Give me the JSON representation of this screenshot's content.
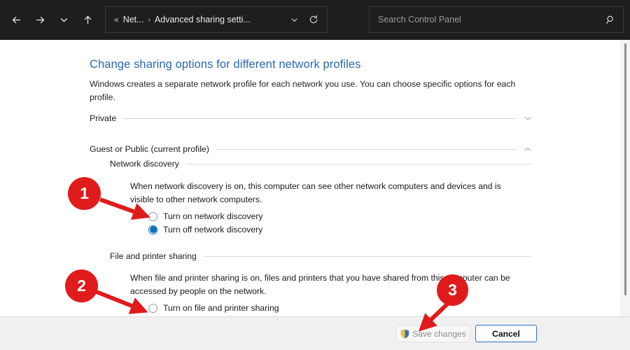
{
  "titlebar": {
    "nav": [
      {
        "name": "back",
        "label": "Back"
      },
      {
        "name": "forward",
        "label": "Forward"
      },
      {
        "name": "recent",
        "label": "Recent locations"
      },
      {
        "name": "up",
        "label": "Up"
      }
    ],
    "address": {
      "overflow_glyph": "«",
      "crumb1": "Net...",
      "separator": "›",
      "crumb2": "Advanced sharing setti...",
      "dropdown_glyph": "⌵",
      "refresh_label": "Refresh"
    },
    "search": {
      "placeholder": "Search Control Panel",
      "value": ""
    }
  },
  "main": {
    "title": "Change sharing options for different network profiles",
    "description": "Windows creates a separate network profile for each network you use. You can choose specific options for each profile.",
    "profiles": [
      {
        "label": "Private",
        "expanded": false,
        "chevron": "chevron-down-icon"
      },
      {
        "label": "Guest or Public (current profile)",
        "expanded": true,
        "chevron": "chevron-up-icon"
      }
    ],
    "sections": [
      {
        "heading": "Network discovery",
        "text": "When network discovery is on, this computer can see other network computers and devices and is visible to other network computers.",
        "options": [
          {
            "label": "Turn on network discovery",
            "checked": false
          },
          {
            "label": "Turn off network discovery",
            "checked": true
          }
        ]
      },
      {
        "heading": "File and printer sharing",
        "text": "When file and printer sharing is on, files and printers that you have shared from this computer can be accessed by people on the network.",
        "options": [
          {
            "label": "Turn on file and printer sharing",
            "checked": false
          }
        ]
      }
    ]
  },
  "footer": {
    "save_label": "Save changes",
    "save_enabled": false,
    "save_icon": "uac-shield-icon",
    "cancel_label": "Cancel"
  },
  "annotations": [
    {
      "number": "1",
      "target": "turn-on-network-discovery-radio"
    },
    {
      "number": "2",
      "target": "turn-on-file-printer-sharing-radio"
    },
    {
      "number": "3",
      "target": "save-changes-button"
    }
  ],
  "colors": {
    "chrome_bg": "#1e1e1e",
    "title_blue": "#2a68b3",
    "accent_blue": "#0d6ebe",
    "annotation_red": "#e01b1b",
    "footer_bg": "#f0f0f0"
  }
}
